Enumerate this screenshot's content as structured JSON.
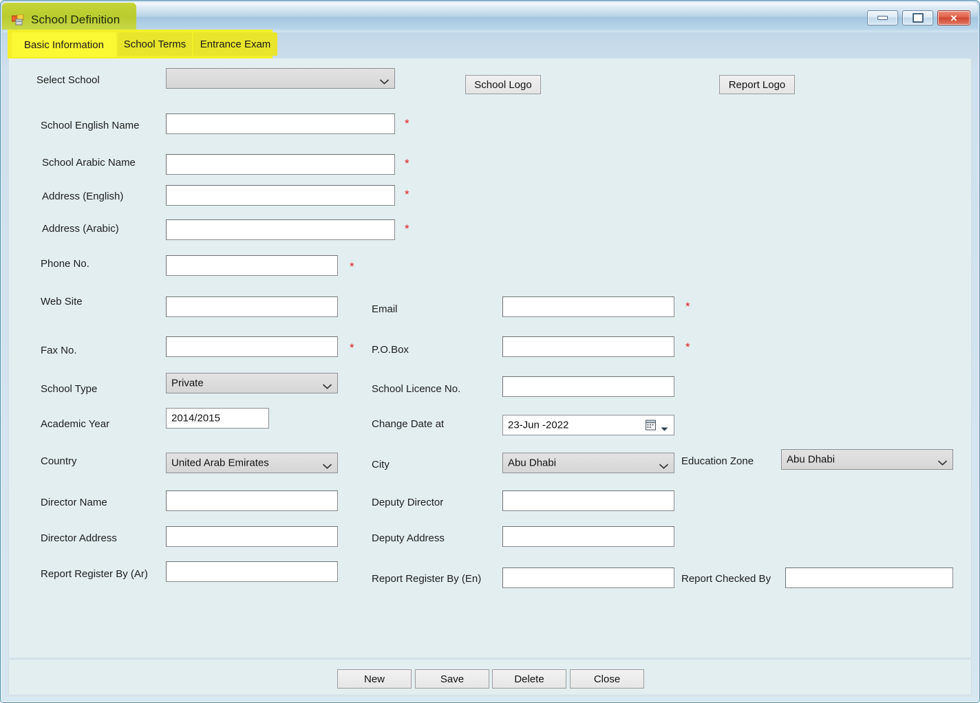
{
  "window": {
    "title": "School Definition",
    "app_icon": "form-icon",
    "controls": {
      "minimize": "minimize-icon",
      "maximize": "maximize-icon",
      "close": "close-icon",
      "close_glyph": "✕"
    },
    "accent_highlight": "#f3f02a",
    "title_highlight": "#bdcf33",
    "client_background": "#e3eef1"
  },
  "tabs": [
    {
      "label": "Basic Information",
      "active": true
    },
    {
      "label": "School Terms",
      "active": false
    },
    {
      "label": "Entrance Exam",
      "active": false
    }
  ],
  "form": {
    "select_school": {
      "label": "Select School",
      "value": "",
      "icon": "chevron-down-icon"
    },
    "school_logo_button": "School Logo",
    "report_logo_button": "Report Logo",
    "school_english_name": {
      "label": "School English Name",
      "value": "",
      "required": "*"
    },
    "school_arabic_name": {
      "label": "School Arabic Name",
      "value": "",
      "required": "*"
    },
    "address_english": {
      "label": "Address (English)",
      "value": "",
      "required": "*"
    },
    "address_arabic": {
      "label": "Address (Arabic)",
      "value": "",
      "required": "*"
    },
    "phone_no": {
      "label": "Phone No.",
      "value": "",
      "required": "*"
    },
    "web_site": {
      "label": "Web Site",
      "value": ""
    },
    "email": {
      "label": "Email",
      "value": "",
      "required": "*"
    },
    "fax_no": {
      "label": "Fax No.",
      "value": "",
      "required": "*"
    },
    "po_box": {
      "label": "P.O.Box",
      "value": "",
      "required": "*"
    },
    "school_type": {
      "label": "School Type",
      "value": "Private",
      "icon": "chevron-down-icon"
    },
    "school_licence_no": {
      "label": "School Licence No.",
      "value": ""
    },
    "academic_year": {
      "label": "Academic Year",
      "value": "2014/2015"
    },
    "change_date_at": {
      "label": "Change Date at",
      "value": "23-Jun -2022",
      "icon": "calendar-icon",
      "arrow": "dropdown-arrow-icon"
    },
    "country": {
      "label": "Country",
      "value": "United Arab Emirates",
      "icon": "chevron-down-icon"
    },
    "city": {
      "label": "City",
      "value": "Abu Dhabi",
      "icon": "chevron-down-icon"
    },
    "education_zone": {
      "label": "Education Zone",
      "value": "Abu Dhabi",
      "icon": "chevron-down-icon"
    },
    "director_name": {
      "label": "Director Name",
      "value": ""
    },
    "deputy_director": {
      "label": "Deputy Director",
      "value": ""
    },
    "director_address": {
      "label": "Director Address",
      "value": ""
    },
    "deputy_address": {
      "label": "Deputy Address",
      "value": ""
    },
    "report_register_ar": {
      "label": "Report Register By (Ar)",
      "value": ""
    },
    "report_register_en": {
      "label": "Report Register By (En)",
      "value": ""
    },
    "report_checked_by": {
      "label": "Report Checked By",
      "value": ""
    }
  },
  "footer": {
    "new": "New",
    "save": "Save",
    "delete": "Delete",
    "close": "Close"
  }
}
